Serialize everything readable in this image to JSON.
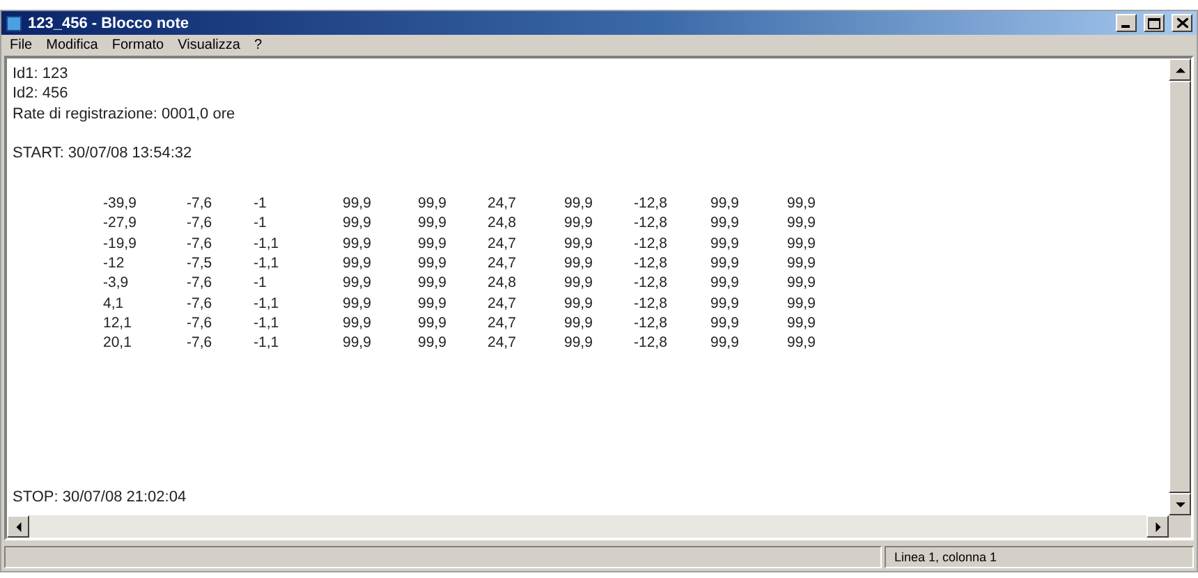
{
  "window": {
    "title": "123_456 - Blocco note"
  },
  "menu": [
    "File",
    "Modifica",
    "Formato",
    "Visualizza",
    "?"
  ],
  "document": {
    "header_lines": [
      "Id1: 123",
      "Id2: 456",
      "Rate di registrazione: 0001,0 ore"
    ],
    "start": "START: 30/07/08 13:54:32",
    "rows": [
      [
        "-39,9",
        "-7,6",
        "-1",
        "99,9",
        "99,9",
        "24,7",
        "99,9",
        "-12,8",
        "99,9",
        "99,9"
      ],
      [
        "-27,9",
        "-7,6",
        "-1",
        "99,9",
        "99,9",
        "24,8",
        "99,9",
        "-12,8",
        "99,9",
        "99,9"
      ],
      [
        "-19,9",
        "-7,6",
        "-1,1",
        "99,9",
        "99,9",
        "24,7",
        "99,9",
        "-12,8",
        "99,9",
        "99,9"
      ],
      [
        "-12",
        "-7,5",
        "-1,1",
        "99,9",
        "99,9",
        "24,7",
        "99,9",
        "-12,8",
        "99,9",
        "99,9"
      ],
      [
        "-3,9",
        "-7,6",
        "-1",
        "99,9",
        "99,9",
        "24,8",
        "99,9",
        "-12,8",
        "99,9",
        "99,9"
      ],
      [
        "4,1",
        "-7,6",
        "-1,1",
        "99,9",
        "99,9",
        "24,7",
        "99,9",
        "-12,8",
        "99,9",
        "99,9"
      ],
      [
        "12,1",
        "-7,6",
        "-1,1",
        "99,9",
        "99,9",
        "24,7",
        "99,9",
        "-12,8",
        "99,9",
        "99,9"
      ],
      [
        "20,1",
        "-7,6",
        "-1,1",
        "99,9",
        "99,9",
        "24,7",
        "99,9",
        "-12,8",
        "99,9",
        "99,9"
      ]
    ],
    "stop": "STOP: 30/07/08 21:02:04"
  },
  "status_bar": {
    "position": "Linea 1, colonna 1"
  }
}
